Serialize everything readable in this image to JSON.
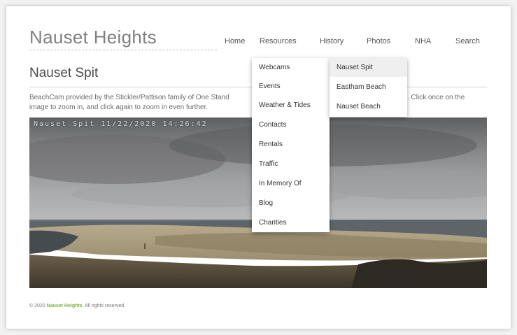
{
  "site": {
    "title": "Nauset Heights"
  },
  "nav": {
    "home": "Home",
    "resources": "Resources",
    "history": "History",
    "photos": "Photos",
    "nha": "NHA",
    "search": "Search"
  },
  "resources_menu": [
    "Webcams",
    "Events",
    "Weather & Tides",
    "Contacts",
    "Rentals",
    "Traffic",
    "In Memory Of",
    "Blog",
    "Charities"
  ],
  "webcams_submenu": [
    "Nauset Spit",
    "Eastham Beach",
    "Nauset Beach"
  ],
  "page": {
    "heading": "Nauset Spit",
    "description_line1": "BeachCam provided by the Stickler/Pattison family of One Stand",
    "description_line2": "image to zoom in, and click again to zoom in even further.",
    "description_right": ". Click once on the"
  },
  "webcam": {
    "overlay_text": "Nauset Spit  11/22/2020  14:26:42"
  },
  "footer": {
    "copyright": "© 2020",
    "brand": "Nauset Heights",
    "rights": ". All rights reserved."
  },
  "colors": {
    "brand_green": "#7cb342",
    "title_gray": "#808080"
  }
}
